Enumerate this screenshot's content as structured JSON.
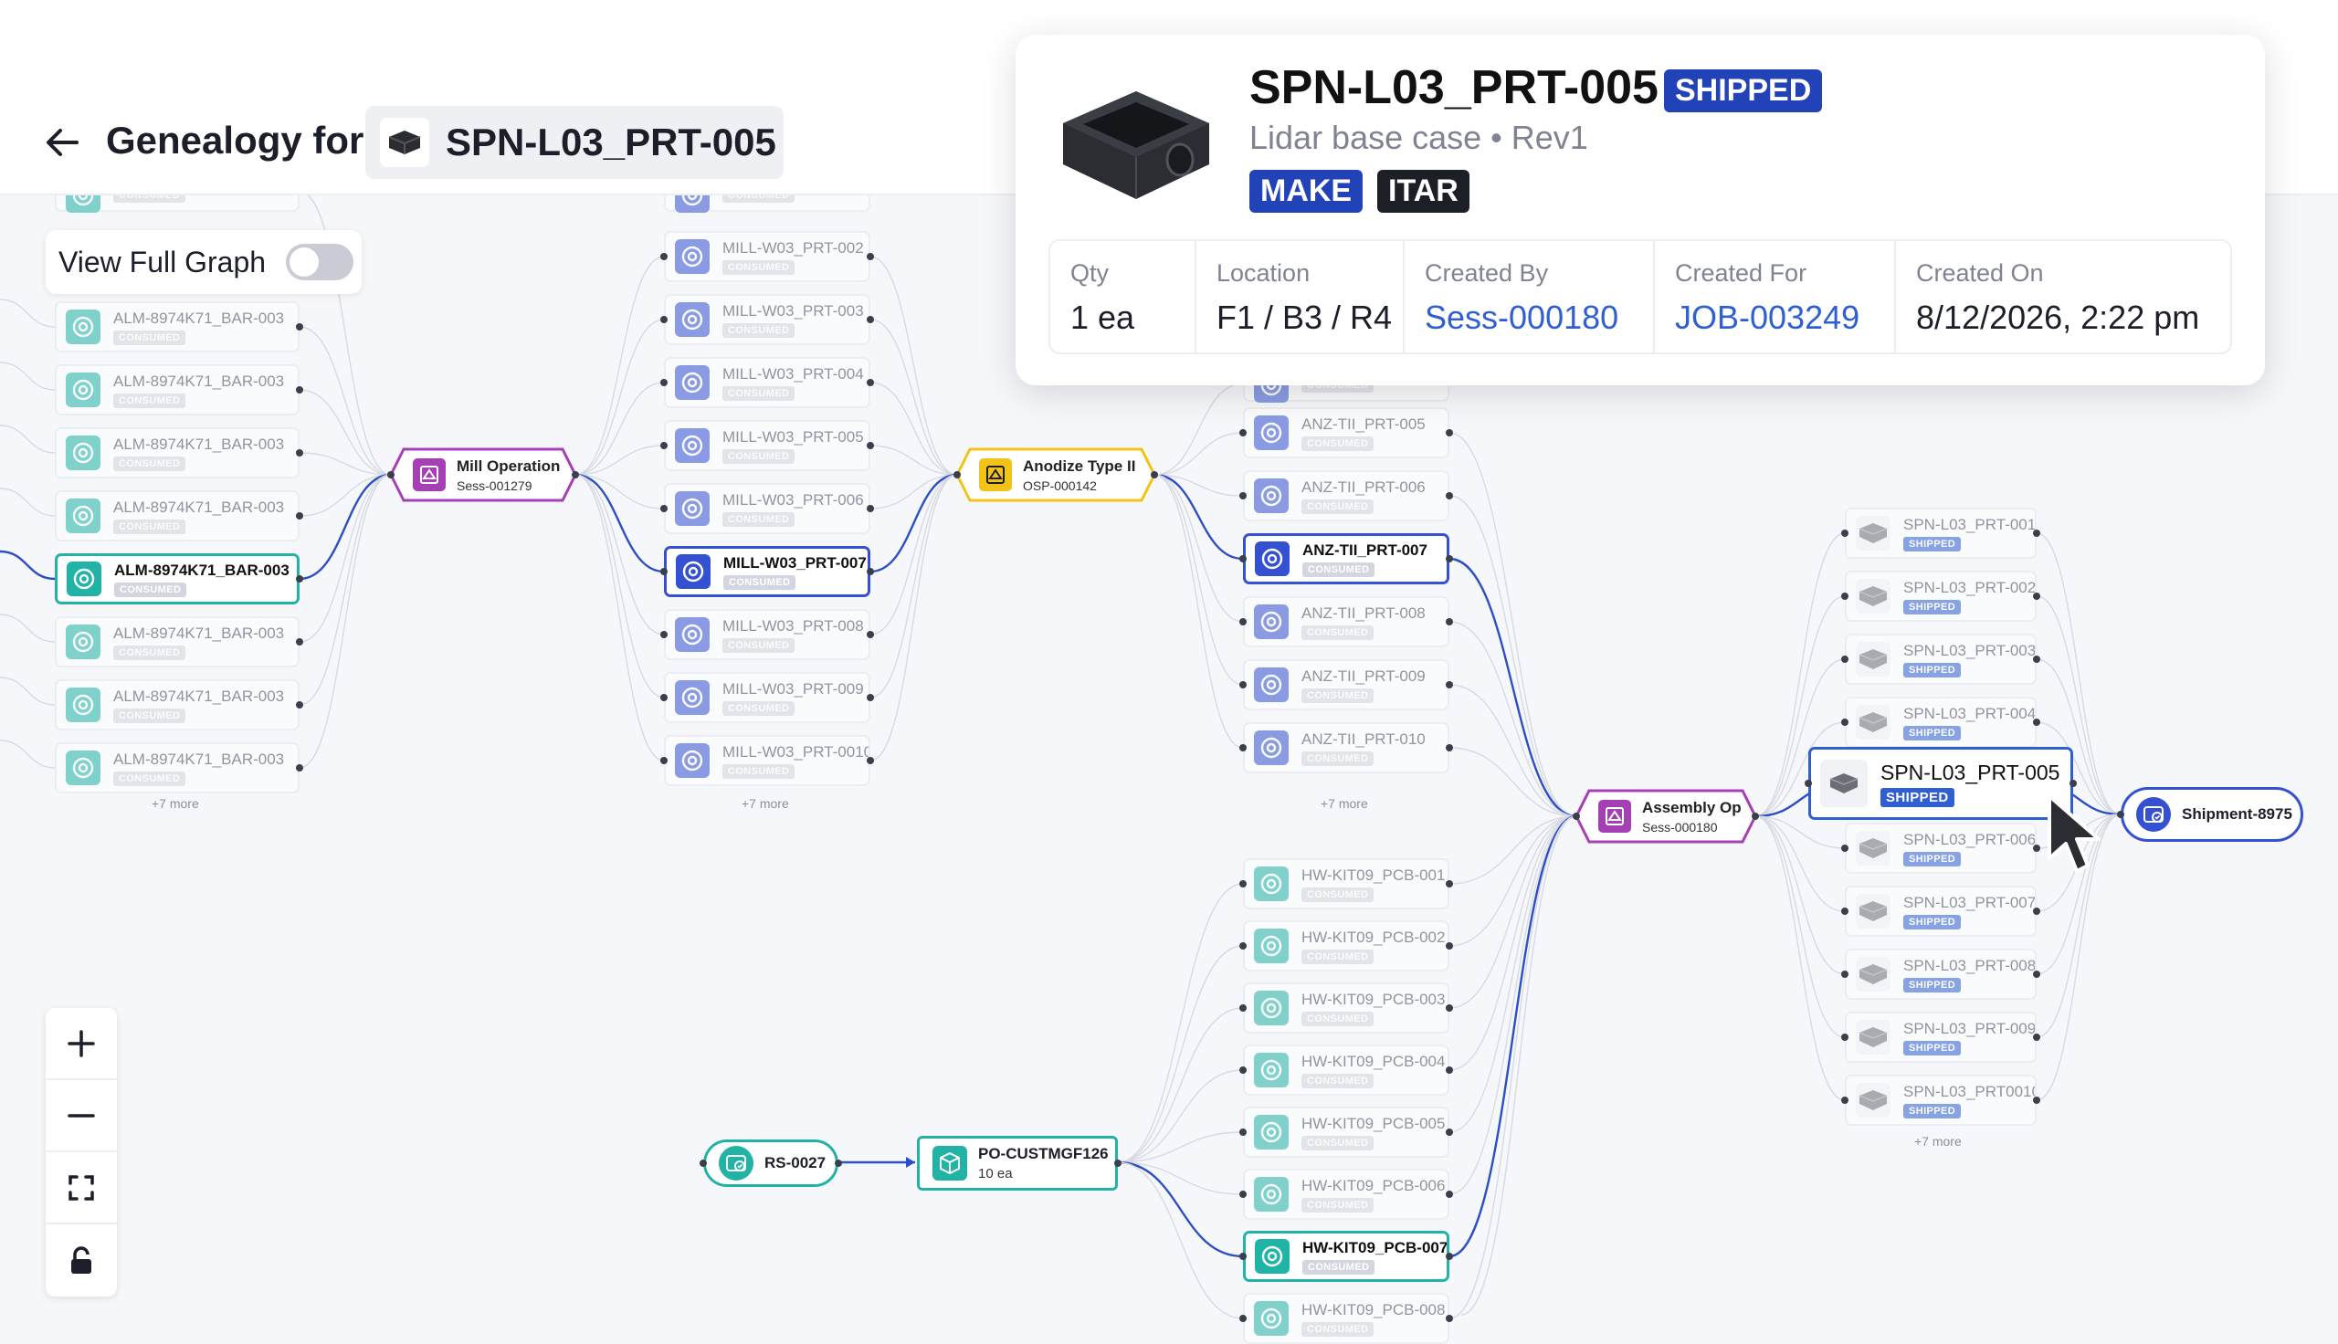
{
  "header": {
    "title": "Genealogy for",
    "part_number": "SPN-L03_PRT-005"
  },
  "toggle": {
    "label": "View Full Graph",
    "on": false
  },
  "columns": {
    "alm": {
      "items": [
        "ALM-8974K71_BAR-003",
        "ALM-8974K71_BAR-003",
        "ALM-8974K71_BAR-003",
        "ALM-8974K71_BAR-003",
        "ALM-8974K71_BAR-003",
        "ALM-8974K71_BAR-003",
        "ALM-8974K71_BAR-003",
        "ALM-8974K71_BAR-003"
      ],
      "partial_top_status": "CONSUMED",
      "status": "CONSUMED",
      "highlight_index": 4,
      "more": "+7 more"
    },
    "mill": {
      "items": [
        "MILL-W03_PRT-002",
        "MILL-W03_PRT-003",
        "MILL-W03_PRT-004",
        "MILL-W03_PRT-005",
        "MILL-W03_PRT-006",
        "MILL-W03_PRT-007",
        "MILL-W03_PRT-008",
        "MILL-W03_PRT-009",
        "MILL-W03_PRT-0010"
      ],
      "partial_top_status": "CONSUMED",
      "status": "CONSUMED",
      "highlight_index": 5,
      "more": "+7 more"
    },
    "anz": {
      "items": [
        "ANZ-TII_PRT-005",
        "ANZ-TII_PRT-006",
        "ANZ-TII_PRT-007",
        "ANZ-TII_PRT-008",
        "ANZ-TII_PRT-009",
        "ANZ-TII_PRT-010"
      ],
      "partial_top_status": "CONSUMED",
      "status": "CONSUMED",
      "highlight_index": 2,
      "more": "+7 more"
    },
    "hw": {
      "items": [
        "HW-KIT09_PCB-001",
        "HW-KIT09_PCB-002",
        "HW-KIT09_PCB-003",
        "HW-KIT09_PCB-004",
        "HW-KIT09_PCB-005",
        "HW-KIT09_PCB-006",
        "HW-KIT09_PCB-007",
        "HW-KIT09_PCB-008"
      ],
      "status": "CONSUMED",
      "highlight_index": 6
    },
    "spn": {
      "items": [
        "SPN-L03_PRT-001",
        "SPN-L03_PRT-002",
        "SPN-L03_PRT-003",
        "SPN-L03_PRT-004",
        "SPN-L03_PRT-005",
        "SPN-L03_PRT-006",
        "SPN-L03_PRT-007",
        "SPN-L03_PRT-008",
        "SPN-L03_PRT-009",
        "SPN-L03_PRT0010"
      ],
      "status": "SHIPPED",
      "highlight_index": 4,
      "more": "+7 more"
    }
  },
  "operations": {
    "mill": {
      "title": "Mill Operation",
      "sub": "Sess-001279"
    },
    "anodize": {
      "title": "Anodize Type II",
      "sub": "OSP-000142"
    },
    "assembly": {
      "title": "Assembly Op",
      "sub": "Sess-000180"
    }
  },
  "receiving": {
    "label": "RS-0027"
  },
  "purchase_order": {
    "label": "PO-CUSTMGF126",
    "qty": "10 ea"
  },
  "shipment": {
    "label": "Shipment-8975"
  },
  "popover": {
    "title": "SPN-L03_PRT-005",
    "status": "SHIPPED",
    "subtitle": "Lidar base case • Rev1",
    "tags": [
      "MAKE",
      "ITAR"
    ],
    "fields": [
      {
        "label": "Qty",
        "value": "1 ea",
        "link": false
      },
      {
        "label": "Location",
        "value": "F1 / B3 / R4",
        "link": false
      },
      {
        "label": "Created By",
        "value": "Sess-000180",
        "link": true
      },
      {
        "label": "Created For",
        "value": "JOB-003249",
        "link": true
      },
      {
        "label": "Created On",
        "value": "8/12/2026, 2:22 pm",
        "link": false
      }
    ]
  },
  "colors": {
    "teal": "#21b3a6",
    "blue": "#3451d1",
    "purple": "#a43fb4",
    "yellow": "#f3c318",
    "shipped": "#2f5fd1",
    "consumed": "#d3d6de",
    "edge_highlight": "#2d4fc4"
  },
  "icons": [
    "back-arrow-icon",
    "teal-part-icon",
    "blue-part-icon",
    "operation-icon",
    "box-3d-icon",
    "receiving-icon",
    "shipment-icon",
    "zoom-in-icon",
    "zoom-out-icon",
    "fit-view-icon",
    "lock-icon"
  ]
}
